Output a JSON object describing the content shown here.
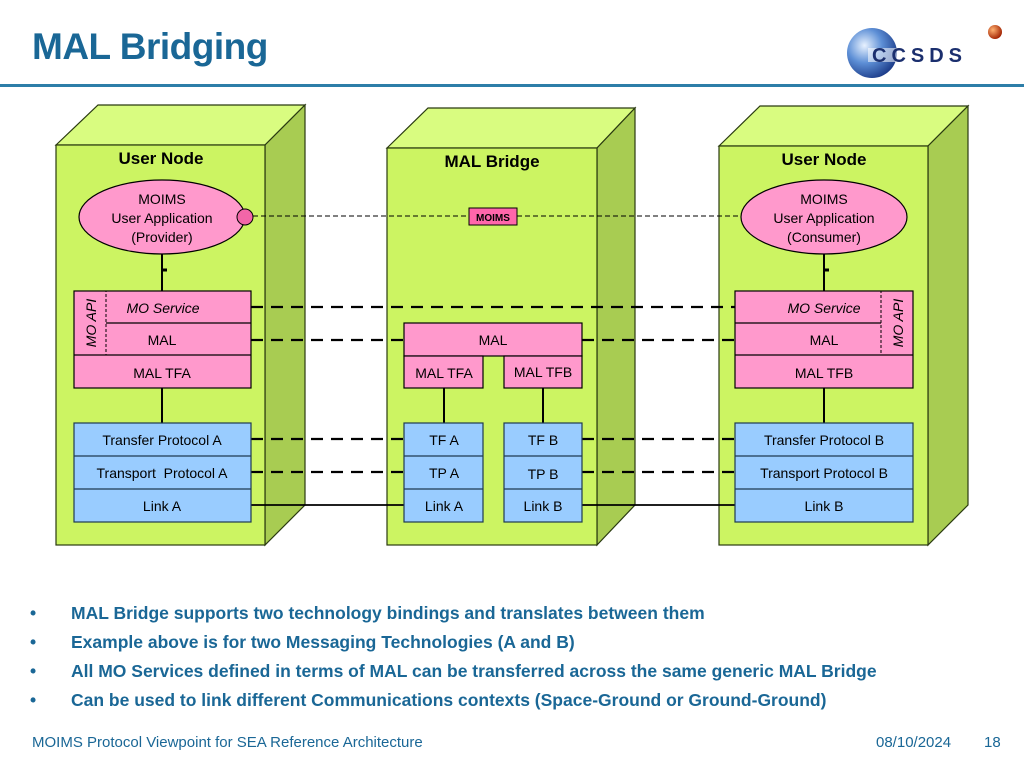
{
  "slide": {
    "title": "MAL Bridging",
    "logo_text": "CCSDS",
    "colors": {
      "title": "#1a6796",
      "node_front": "#ccf462",
      "node_top": "#d9fc80",
      "node_side": "#a8cc52",
      "pink": "#ff99cc",
      "blue": "#99ccff",
      "moims_tag": "#ff66aa"
    }
  },
  "diagram": {
    "nodes": [
      {
        "label": "User Node",
        "app": [
          "MOIMS",
          "User Application",
          "(Provider)"
        ],
        "api_label": "MO API",
        "service": "MO Service",
        "mal": "MAL",
        "mal_tf": "MAL TFA",
        "stack": [
          "Transfer Protocol A",
          "Transport  Protocol A",
          "Link A"
        ]
      },
      {
        "label": "MAL Bridge",
        "tag": "MOIMS",
        "mal": "MAL",
        "mal_tf_a": "MAL TFA",
        "mal_tf_b": "MAL TFB",
        "stack_a": [
          "TF A",
          "TP A",
          "Link A"
        ],
        "stack_b": [
          "TF B",
          "TP B",
          "Link B"
        ]
      },
      {
        "label": "User Node",
        "app": [
          "MOIMS",
          "User Application",
          "(Consumer)"
        ],
        "api_label": "MO API",
        "service": "MO Service",
        "mal": "MAL",
        "mal_tf": "MAL TFB",
        "stack": [
          "Transfer Protocol B",
          "Transport Protocol B",
          "Link B"
        ]
      }
    ]
  },
  "bullets": [
    "MAL Bridge supports two technology bindings and translates between them",
    "Example above is for two Messaging Technologies (A and B)",
    "All MO Services defined in terms of MAL can be transferred across the same generic MAL Bridge",
    "Can be used to link different Communications contexts (Space-Ground or Ground-Ground)"
  ],
  "bullet_glyph": "•",
  "footer": {
    "text": "MOIMS Protocol Viewpoint for SEA Reference Architecture",
    "date": "08/10/2024",
    "page": "18"
  }
}
